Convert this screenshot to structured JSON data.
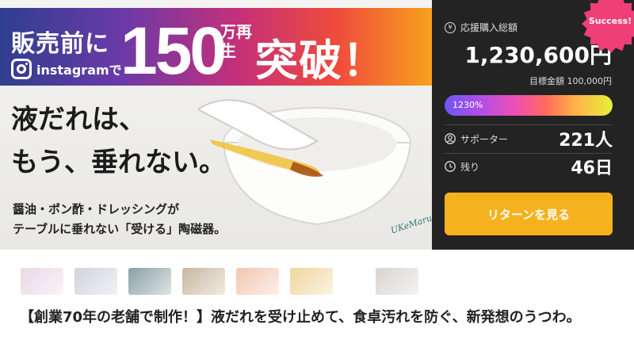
{
  "hero": {
    "banner_prefix": "販売前に",
    "instagram_text": "instagramで",
    "views_number": "150",
    "views_unit": "万再生",
    "breakthrough": "突破！",
    "headline_line1": "液だれは、",
    "headline_line2": "もう、垂れない。",
    "sub_line1": "醤油・ポン酢・ドレッシングが",
    "sub_line2": "テーブルに垂れない「受ける」陶磁器。",
    "brand_logo": "UKeMaru."
  },
  "badge": {
    "label": "Success!",
    "color": "#ef3e78"
  },
  "panel": {
    "total_label": "応援購入総額",
    "total_amount": "1,230,600円",
    "target_text": "目標金額 100,000円",
    "progress_label": "1230%",
    "progress_fraction": 1.0,
    "supporters_label": "サポーター",
    "supporters_value": "221人",
    "remaining_label": "残り",
    "remaining_value": "46日",
    "cta_label": "リターンを見る",
    "cta_color": "#f6b21e"
  },
  "thumbnails": [
    {
      "name": "thumb-1",
      "color": "#e9d8e6"
    },
    {
      "name": "thumb-2",
      "color": "#cfd3dc"
    },
    {
      "name": "thumb-3",
      "color": "#8aa0a6"
    },
    {
      "name": "thumb-4",
      "color": "#c9b79f"
    },
    {
      "name": "thumb-5",
      "color": "#f1c7b0"
    },
    {
      "name": "thumb-6",
      "color": "#f0d59c"
    },
    {
      "name": "thumb-7",
      "color": "#d8d5d0"
    }
  ],
  "project_title": "【創業70年の老舗で制作！】液だれを受け止めて、食卓汚れを防ぐ、新発想のうつわ。"
}
